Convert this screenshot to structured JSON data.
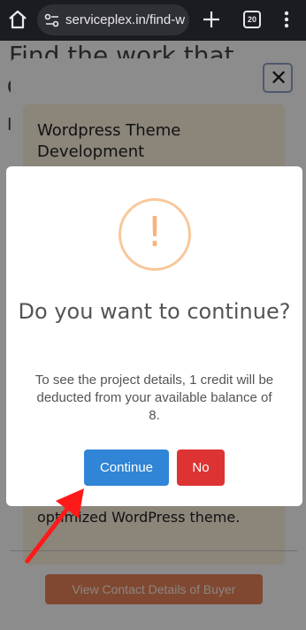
{
  "browser": {
    "url": "serviceplex.in/find-w",
    "tab_count": "20"
  },
  "background": {
    "heading": "Find the work that",
    "heading_line2": "c",
    "line3": "I"
  },
  "job_modal": {
    "close_label": "✕",
    "title": "Wordpress Theme Development",
    "desc": "d…e working, responsive and optimized WordPress theme.",
    "contact_button": "View Contact Details of Buyer"
  },
  "dialog": {
    "icon": "!",
    "title": "Do you want to continue?",
    "text": "To see the project details, 1 credit will be deducted from your available balance of 8.",
    "continue_label": "Continue",
    "no_label": "No"
  },
  "colors": {
    "continue": "#3085d6",
    "no": "#dd3333",
    "warning": "#f8bb86",
    "contact": "#e9835a",
    "arrow": "#ff1a1a"
  }
}
